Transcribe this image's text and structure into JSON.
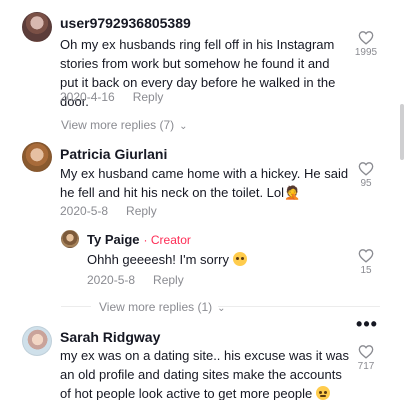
{
  "comments": [
    {
      "username": "user9792936805389",
      "text": "Oh my ex husbands ring fell off in his Instagram stories from work but somehow he found it and put it back on every day before he walked in the door.",
      "date": "2020-4-16",
      "reply_label": "Reply",
      "likes": "1995",
      "view_more": "View more replies (7)"
    },
    {
      "username": "Patricia Giurlani",
      "text": "My ex husband came home with a hickey. He said he fell and hit his neck on the toilet. Lol🤦",
      "date": "2020-5-8",
      "reply_label": "Reply",
      "likes": "95",
      "reply": {
        "username": "Ty Paige",
        "badge": "Creator",
        "text": "Ohhh geeeesh! I'm sorry",
        "date": "2020-5-8",
        "reply_label": "Reply",
        "likes": "15"
      },
      "view_more": "View more replies (1)"
    },
    {
      "username": "Sarah Ridgway",
      "text": "my ex was on a dating site.. his excuse was it was an old profile and dating sites make the accounts of hot people look active to get more people",
      "likes": "717",
      "more_label": "•••"
    }
  ],
  "icons": {
    "like": "heart-outline-icon",
    "chevron": "chevron-down-icon",
    "emoji_grimace": "grimacing-face-icon",
    "emoji_flushed": "flushed-face-icon"
  },
  "colors": {
    "text": "#161823",
    "muted": "#8a8b91",
    "creator": "#fe2c55"
  }
}
